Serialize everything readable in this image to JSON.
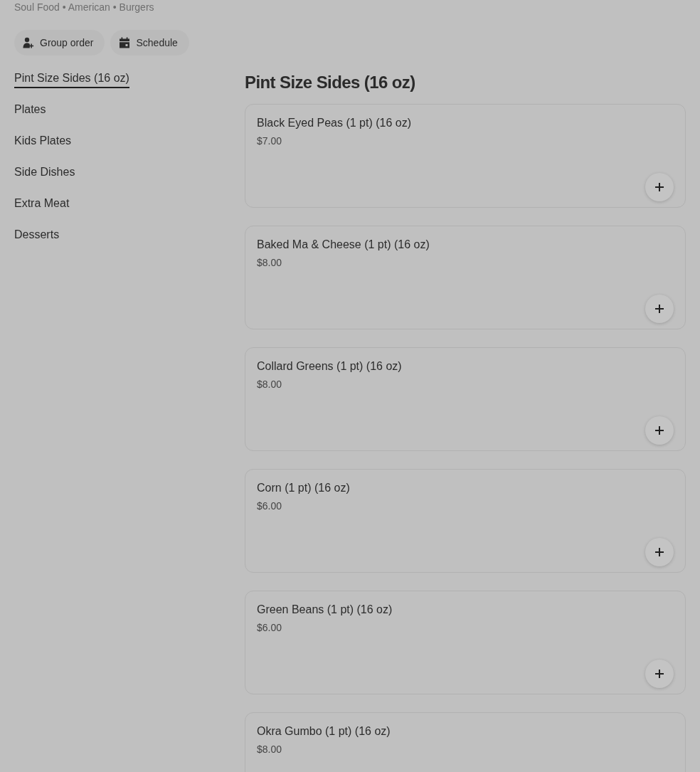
{
  "header": {
    "cuisines": "Soul Food • American • Burgers"
  },
  "actions": [
    {
      "kind": "group",
      "label": "Group order"
    },
    {
      "kind": "schedule",
      "label": "Schedule"
    }
  ],
  "sidebar": {
    "items": [
      {
        "label": "Pint Size Sides (16 oz)",
        "selected": true
      },
      {
        "label": "Plates",
        "selected": false
      },
      {
        "label": "Kids Plates",
        "selected": false
      },
      {
        "label": "Side Dishes",
        "selected": false
      },
      {
        "label": "Extra Meat",
        "selected": false
      },
      {
        "label": "Desserts",
        "selected": false
      }
    ]
  },
  "section": {
    "title": "Pint Size Sides (16 oz)",
    "items": [
      {
        "name": "Black Eyed Peas (1 pt) (16 oz)",
        "price": "$7.00"
      },
      {
        "name": "Baked Ma & Cheese (1 pt) (16 oz)",
        "price": "$8.00"
      },
      {
        "name": "Collard Greens (1 pt) (16 oz)",
        "price": "$8.00"
      },
      {
        "name": "Corn (1 pt) (16 oz)",
        "price": "$6.00"
      },
      {
        "name": "Green Beans (1 pt) (16 oz)",
        "price": "$6.00"
      },
      {
        "name": "Okra Gumbo (1 pt) (16 oz)",
        "price": "$8.00"
      }
    ]
  }
}
